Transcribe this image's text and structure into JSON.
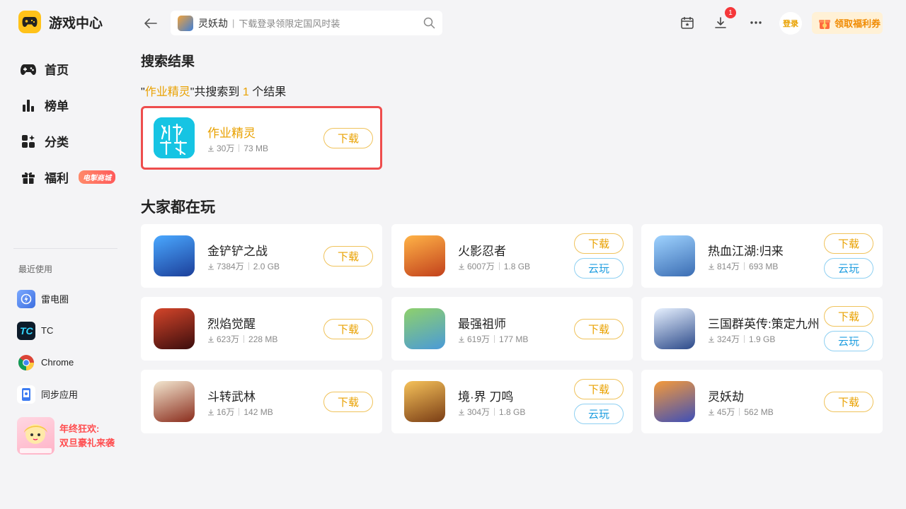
{
  "app": {
    "title": "游戏中心"
  },
  "sidebar": {
    "nav": [
      {
        "label": "首页",
        "icon": "gamepad-icon"
      },
      {
        "label": "榜单",
        "icon": "ranking-icon"
      },
      {
        "label": "分类",
        "icon": "category-icon"
      },
      {
        "label": "福利",
        "icon": "gift-icon",
        "badge": "电掣商城"
      }
    ],
    "recent_title": "最近使用",
    "recent": [
      {
        "label": "雷电圈",
        "icon": "leidian-circle-icon",
        "color": "#4a8cff"
      },
      {
        "label": "TC",
        "icon": "tc-icon",
        "color": "#0d1b2a"
      },
      {
        "label": "Chrome",
        "icon": "chrome-icon",
        "color": "#ffffff"
      },
      {
        "label": "同步应用",
        "icon": "sync-app-icon",
        "color": "#ffffff"
      }
    ],
    "promo": {
      "line1": "年终狂欢:",
      "line2": "双旦豪礼来袭"
    }
  },
  "header": {
    "search": {
      "game": "灵妖劫",
      "hint": "下载登录领限定国风时装"
    },
    "download_badge": "1",
    "login_label": "登录",
    "coupon_label": "领取福利券"
  },
  "results": {
    "title": "搜索结果",
    "query": "作业精灵",
    "prefix_quote": "\"",
    "mid_text": "\"共搜索到",
    "count": "1",
    "suffix": "个结果",
    "items": [
      {
        "name": "作业精灵",
        "downloads": "30万",
        "size": "73 MB",
        "download_label": "下载"
      }
    ]
  },
  "popular": {
    "title": "大家都在玩",
    "download_label": "下载",
    "cloud_label": "云玩",
    "items": [
      {
        "name": "金铲铲之战",
        "downloads": "7384万",
        "size": "2.0 GB",
        "cloud": false
      },
      {
        "name": "火影忍者",
        "downloads": "6007万",
        "size": "1.8 GB",
        "cloud": true
      },
      {
        "name": "热血江湖:归来",
        "downloads": "814万",
        "size": "693 MB",
        "cloud": true
      },
      {
        "name": "烈焰觉醒",
        "downloads": "623万",
        "size": "228 MB",
        "cloud": false
      },
      {
        "name": "最强祖师",
        "downloads": "619万",
        "size": "177 MB",
        "cloud": false
      },
      {
        "name": "三国群英传:策定九州",
        "downloads": "324万",
        "size": "1.9 GB",
        "cloud": true
      },
      {
        "name": "斗转武林",
        "downloads": "16万",
        "size": "142 MB",
        "cloud": false
      },
      {
        "name": "境·界 刀鸣",
        "downloads": "304万",
        "size": "1.8 GB",
        "cloud": true
      },
      {
        "name": "灵妖劫",
        "downloads": "45万",
        "size": "562 MB",
        "cloud": false
      }
    ]
  }
}
